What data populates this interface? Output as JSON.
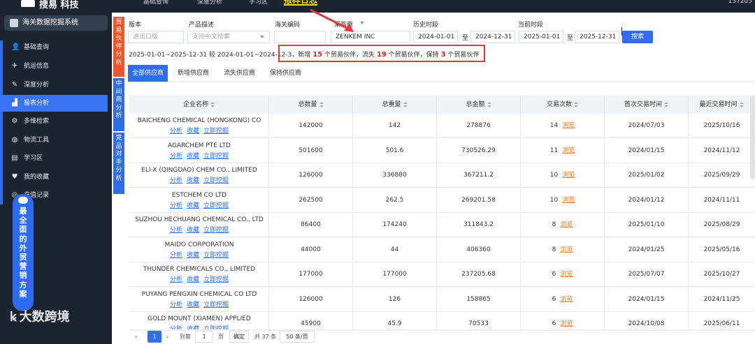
{
  "topbar": {
    "logo": "搜易 科技",
    "nav": [
      "基础查询",
      "深度分析",
      "学习区"
    ],
    "highlight": "报样日志",
    "right_num": "137205"
  },
  "sidebar": {
    "system_title": "海关数据挖掘系统",
    "items": [
      {
        "label": "基础查询",
        "icon": "user-icon"
      },
      {
        "label": "航运信息",
        "icon": "plane-icon"
      },
      {
        "label": "深度分析",
        "icon": "pen-icon"
      },
      {
        "label": "报表分析",
        "icon": "chart-icon",
        "active": true
      },
      {
        "label": "多维检索",
        "icon": "filter-icon"
      },
      {
        "label": "物流工具",
        "icon": "globe-icon"
      },
      {
        "label": "学习区",
        "icon": "book-icon"
      },
      {
        "label": "我的收藏",
        "icon": "heart-icon"
      },
      {
        "label": "充值记录",
        "icon": "coin-icon"
      }
    ],
    "promo": "最全面的外贸营销方案",
    "watermark": "大数跨境"
  },
  "vtabs": [
    {
      "label": "贸易伙伴分析",
      "color": "#f0562a"
    },
    {
      "label": "中间商分析",
      "color": "#2e6de8"
    },
    {
      "label": "竞品对手分析",
      "color": "#2e6de8"
    }
  ],
  "filters": {
    "labels": {
      "version": "版本",
      "product": "产品描述",
      "hscode": "海关编码",
      "buyer": "采购商",
      "history": "历史时段",
      "current": "当前时段"
    },
    "version_placeholder": "进出口版",
    "product_placeholder": "支持中文检索",
    "hscode_value": "",
    "buyer_value": "ZENKEM INC",
    "history_start": "2024-01-01",
    "history_end": "2024-12-31",
    "current_start": "2025-01-01",
    "current_end": "2025-12-31",
    "to_label": "至",
    "search_label": "搜索"
  },
  "summary": {
    "range_text": "2025-01-01~2025-12-31 较 2024-01-01~2024-12-3",
    "p1": "，新增",
    "new_count": "15",
    "p2": "个贸易伙伴，流失",
    "lost_count": "19",
    "p3": "个贸易伙伴，保持",
    "kept_count": "3",
    "p4": "个贸易伙伴"
  },
  "tabs": [
    "全部供应商",
    "新增供应商",
    "流失供应商",
    "保持供应商"
  ],
  "table": {
    "headers": [
      "企业名称",
      "总数量",
      "总重量",
      "总金额",
      "交易次数",
      "首次交易时间",
      "最近交易时间"
    ],
    "link_labels": [
      "分析",
      "收藏",
      "立即挖掘"
    ],
    "browse_label": "浏览",
    "rows": [
      {
        "name": "BAICHENG CHEMICAL (HONGKONG) CO",
        "qty": "142000",
        "weight": "142",
        "amount": "278876",
        "times": "14",
        "first": "2024/07/03",
        "last": "2025/10/16"
      },
      {
        "name": "AGARCHEM PTE LTD",
        "qty": "501600",
        "weight": "501.6",
        "amount": "730526.29",
        "times": "11",
        "first": "2024/01/15",
        "last": "2024/11/12"
      },
      {
        "name": "ELI-X (QINGDAO) CHEM CO., LIMITED",
        "qty": "126000",
        "weight": "336880",
        "amount": "367211.2",
        "times": "10",
        "first": "2025/01/02",
        "last": "2025/09/29"
      },
      {
        "name": "ESTCHEM CO LTD",
        "qty": "262500",
        "weight": "262.5",
        "amount": "269201.58",
        "times": "10",
        "first": "2024/01/12",
        "last": "2024/11/11"
      },
      {
        "name": "SUZHOU HECHUANG CHEMICAL CO., LTD",
        "qty": "86400",
        "weight": "174240",
        "amount": "311843.2",
        "times": "8",
        "first": "2025/01/10",
        "last": "2025/08/29"
      },
      {
        "name": "MAIDO CORPORATION",
        "qty": "44000",
        "weight": "44",
        "amount": "406360",
        "times": "8",
        "first": "2024/01/25",
        "last": "2025/05/16"
      },
      {
        "name": "THUNDER CHEMICALS CO., LIMITED",
        "qty": "177000",
        "weight": "177000",
        "amount": "237205.68",
        "times": "6",
        "first": "2025/07/07",
        "last": "2025/10/27"
      },
      {
        "name": "PUYANG PENGXIN CHEMICAL CO LTD",
        "qty": "126000",
        "weight": "126",
        "amount": "158865",
        "times": "6",
        "first": "2024/01/15",
        "last": "2024/11/25"
      },
      {
        "name": "GOLD MOUNT (XIAMEN) APPLIED",
        "qty": "45900",
        "weight": "45.9",
        "amount": "70533",
        "times": "6",
        "first": "2024/10/08",
        "last": "2025/06/11"
      }
    ]
  },
  "pager": {
    "current": "1",
    "goto_label": "到第",
    "goto_value": "1",
    "page_unit": "页",
    "confirm": "确定",
    "total": "共 37 条",
    "page_size": "50 条/页"
  },
  "colors": {
    "accent": "#2f6ef0",
    "orange": "#f0562a",
    "highlight_red": "#e23a3a",
    "sidebar_bg": "#1c2430"
  }
}
